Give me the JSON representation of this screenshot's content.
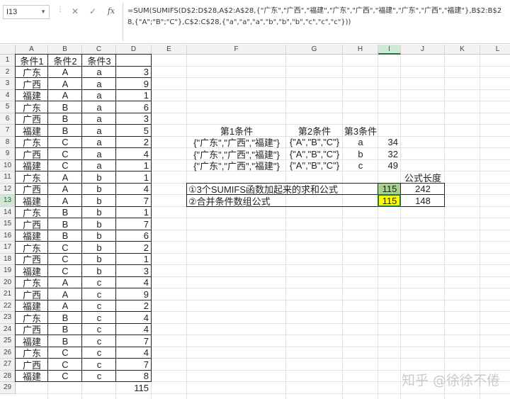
{
  "formula_bar": {
    "name_box": "I13",
    "cancel_glyph": "✕",
    "enter_glyph": "✓",
    "fx_label": "fx",
    "formula": "=SUM(SUMIFS(D$2:D$28,A$2:A$28,{\"广东\",\"广西\",\"福建\",\"广东\",\"广西\",\"福建\",\"广东\",\"广西\",\"福建\"},B$2:B$28,{\"A\";\"B\";\"C\"},C$2:C$28,{\"a\",\"a\",\"a\",\"b\",\"b\",\"b\",\"c\",\"c\",\"c\"}))"
  },
  "columns": [
    "A",
    "B",
    "C",
    "D",
    "E",
    "F",
    "G",
    "H",
    "I",
    "J",
    "K",
    "L"
  ],
  "rows": [
    "1",
    "2",
    "3",
    "4",
    "5",
    "6",
    "7",
    "8",
    "9",
    "10",
    "11",
    "12",
    "13",
    "14",
    "15",
    "16",
    "17",
    "18",
    "19",
    "20",
    "21",
    "22",
    "23",
    "24",
    "25",
    "26",
    "27",
    "28",
    "29"
  ],
  "table": {
    "headers": [
      "条件1",
      "条件2",
      "条件3"
    ],
    "data": [
      [
        "广东",
        "A",
        "a",
        "3"
      ],
      [
        "广西",
        "A",
        "a",
        "9"
      ],
      [
        "福建",
        "A",
        "a",
        "1"
      ],
      [
        "广东",
        "B",
        "a",
        "6"
      ],
      [
        "广西",
        "B",
        "a",
        "3"
      ],
      [
        "福建",
        "B",
        "a",
        "5"
      ],
      [
        "广东",
        "C",
        "a",
        "2"
      ],
      [
        "广西",
        "C",
        "a",
        "4"
      ],
      [
        "福建",
        "C",
        "a",
        "1"
      ],
      [
        "广东",
        "A",
        "b",
        "1"
      ],
      [
        "广西",
        "A",
        "b",
        "4"
      ],
      [
        "福建",
        "A",
        "b",
        "7"
      ],
      [
        "广东",
        "B",
        "b",
        "1"
      ],
      [
        "广西",
        "B",
        "b",
        "7"
      ],
      [
        "福建",
        "B",
        "b",
        "6"
      ],
      [
        "广东",
        "C",
        "b",
        "2"
      ],
      [
        "广西",
        "C",
        "b",
        "1"
      ],
      [
        "福建",
        "C",
        "b",
        "3"
      ],
      [
        "广东",
        "A",
        "c",
        "4"
      ],
      [
        "广西",
        "A",
        "c",
        "9"
      ],
      [
        "福建",
        "A",
        "c",
        "2"
      ],
      [
        "广东",
        "B",
        "c",
        "4"
      ],
      [
        "广西",
        "B",
        "c",
        "4"
      ],
      [
        "福建",
        "B",
        "c",
        "7"
      ],
      [
        "广东",
        "C",
        "c",
        "4"
      ],
      [
        "广西",
        "C",
        "c",
        "7"
      ],
      [
        "福建",
        "C",
        "c",
        "8"
      ]
    ],
    "total": "115"
  },
  "conditions": {
    "headers": [
      "第1条件",
      "第2条件",
      "第3条件"
    ],
    "rows": [
      [
        "{\"广东\",\"广西\",\"福建\"}",
        "{\"A\",\"B\",\"C\"}",
        "a",
        "34"
      ],
      [
        "{\"广东\",\"广西\",\"福建\"}",
        "{\"A\",\"B\",\"C\"}",
        "b",
        "32"
      ],
      [
        "{\"广东\",\"广西\",\"福建\"}",
        "{\"A\",\"B\",\"C\"}",
        "c",
        "49"
      ]
    ]
  },
  "summary": {
    "length_header": "公式长度",
    "rows": [
      {
        "label": "①3个SUMIFS函数加起来的求和公式",
        "value": "115",
        "length": "242"
      },
      {
        "label": "②合并条件数组公式",
        "value": "115",
        "length": "148"
      }
    ]
  },
  "watermark": "知乎 @徐徐不倦",
  "colors": {
    "green_fill": "#a9d08e",
    "yellow_fill": "#ffff00",
    "select_green": "#217346"
  }
}
